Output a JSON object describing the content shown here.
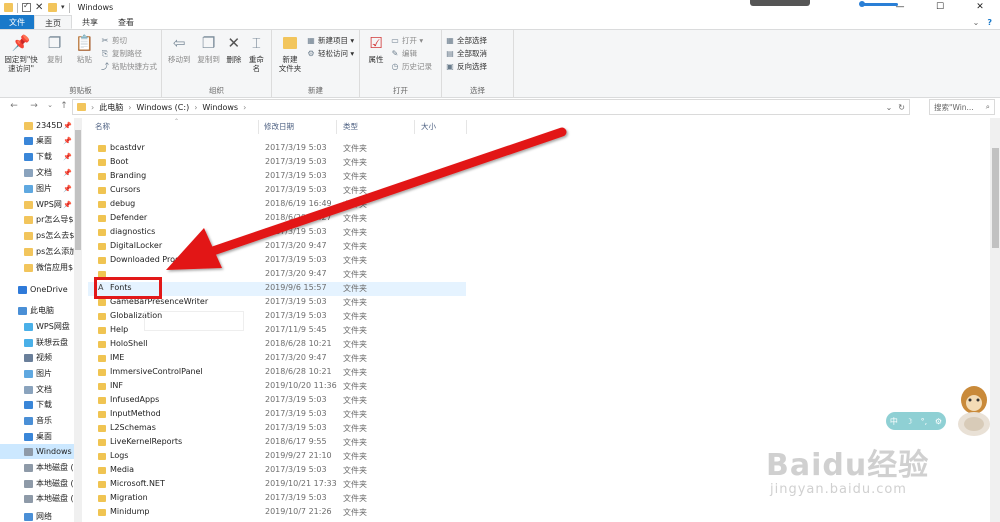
{
  "window": {
    "title": "Windows",
    "controls": {
      "minimize": "—",
      "maximize": "☐",
      "close": "✕"
    }
  },
  "ribbon": {
    "tabs": [
      {
        "label": "文件",
        "kind": "file"
      },
      {
        "label": "主页",
        "kind": "active"
      },
      {
        "label": "共享",
        "kind": "normal"
      },
      {
        "label": "查看",
        "kind": "normal"
      }
    ],
    "right_icons": {
      "expand": "⌄",
      "help": "?"
    },
    "groups": {
      "clipboard": {
        "label": "剪贴板",
        "pin": "固定到\"快速访问\"",
        "copy": "复制",
        "paste": "粘贴",
        "cut": "剪切",
        "copy_path": "复制路径",
        "paste_shortcut": "粘贴快捷方式"
      },
      "organize": {
        "label": "组织",
        "move_to": "移动到",
        "copy_to": "复制到",
        "delete": "删除",
        "rename": "重命名"
      },
      "new": {
        "label": "新建",
        "new_folder": "新建\n文件夹",
        "new_item": "新建项目 ▾",
        "easy_access": "轻松访问 ▾"
      },
      "open": {
        "label": "打开",
        "properties": "属性",
        "open": "打开 ▾",
        "edit": "编辑",
        "history": "历史记录"
      },
      "select": {
        "label": "选择",
        "select_all": "全部选择",
        "select_none": "全部取消",
        "invert": "反向选择"
      }
    }
  },
  "address": {
    "crumbs": [
      "此电脑",
      "Windows (C:)",
      "Windows"
    ],
    "search_placeholder": "搜索\"Win...",
    "back": "←",
    "forward": "→",
    "recent": "⌄",
    "up": "↑",
    "dropdown": "⌄",
    "refresh": "↻",
    "search_icon": "⌕"
  },
  "nav_pane": {
    "items": [
      {
        "label": "2345D",
        "icon": "folder",
        "pinned": true
      },
      {
        "label": "桌面",
        "icon": "desktop",
        "pinned": true
      },
      {
        "label": "下载",
        "icon": "download",
        "pinned": true
      },
      {
        "label": "文档",
        "icon": "doc",
        "pinned": true
      },
      {
        "label": "图片",
        "icon": "pic",
        "pinned": true
      },
      {
        "label": "WPS网",
        "icon": "folder",
        "pinned": true
      },
      {
        "label": "pr怎么导$",
        "icon": "folder",
        "pinned": false
      },
      {
        "label": "ps怎么去$",
        "icon": "folder",
        "pinned": false
      },
      {
        "label": "ps怎么添加",
        "icon": "folder",
        "pinned": false
      },
      {
        "label": "微信应用$",
        "icon": "folder",
        "pinned": false
      },
      {
        "label": "OneDrive",
        "icon": "onedrive",
        "pinned": false
      },
      {
        "label": "此电脑",
        "icon": "pc",
        "pinned": false
      },
      {
        "label": "WPS网盘",
        "icon": "cloud",
        "pinned": false
      },
      {
        "label": "联想云盘",
        "icon": "cloud",
        "pinned": false
      },
      {
        "label": "视频",
        "icon": "video",
        "pinned": false
      },
      {
        "label": "图片",
        "icon": "pic",
        "pinned": false
      },
      {
        "label": "文档",
        "icon": "doc",
        "pinned": false
      },
      {
        "label": "下载",
        "icon": "download",
        "pinned": false
      },
      {
        "label": "音乐",
        "icon": "music",
        "pinned": false
      },
      {
        "label": "桌面",
        "icon": "desktop",
        "pinned": false
      },
      {
        "label": "Windows",
        "icon": "drive",
        "pinned": false,
        "selected": true
      },
      {
        "label": "本地磁盘 (",
        "icon": "drive",
        "pinned": false
      },
      {
        "label": "本地磁盘 (",
        "icon": "drive",
        "pinned": false
      },
      {
        "label": "本地磁盘 (",
        "icon": "drive",
        "pinned": false
      },
      {
        "label": "网络",
        "icon": "network",
        "pinned": false
      }
    ]
  },
  "file_list": {
    "columns": {
      "name": "名称",
      "date": "修改日期",
      "type": "类型",
      "size": "大小"
    },
    "rows": [
      {
        "name": "bcastdvr",
        "date": "2017/3/19 5:03",
        "type": "文件夹"
      },
      {
        "name": "Boot",
        "date": "2017/3/19 5:03",
        "type": "文件夹"
      },
      {
        "name": "Branding",
        "date": "2017/3/19 5:03",
        "type": "文件夹"
      },
      {
        "name": "Cursors",
        "date": "2017/3/19 5:03",
        "type": "文件夹"
      },
      {
        "name": "debug",
        "date": "2018/6/19 16:49",
        "type": "文件夹"
      },
      {
        "name": "Defender",
        "date": "2018/6/20 17:27",
        "type": "文件夹"
      },
      {
        "name": "diagnostics",
        "date": "2017/3/19 5:03",
        "type": "文件夹"
      },
      {
        "name": "DigitalLocker",
        "date": "2017/3/20 9:47",
        "type": "文件夹"
      },
      {
        "name": "Downloaded Program Files",
        "date": "2017/3/19 5:03",
        "type": "文件夹"
      },
      {
        "name": "",
        "date": "2017/3/20 9:47",
        "type": "文件夹"
      },
      {
        "name": "Fonts",
        "date": "2019/9/6 15:57",
        "type": "文件夹",
        "selected": true,
        "icon": "fonts"
      },
      {
        "name": "GameBarPresenceWriter",
        "date": "2017/3/19 5:03",
        "type": "文件夹"
      },
      {
        "name": "Globalization",
        "date": "2017/3/19 5:03",
        "type": "文件夹"
      },
      {
        "name": "Help",
        "date": "2017/11/9 5:45",
        "type": "文件夹"
      },
      {
        "name": "HoloShell",
        "date": "2018/6/28 10:21",
        "type": "文件夹"
      },
      {
        "name": "IME",
        "date": "2017/3/20 9:47",
        "type": "文件夹"
      },
      {
        "name": "ImmersiveControlPanel",
        "date": "2018/6/28 10:21",
        "type": "文件夹"
      },
      {
        "name": "INF",
        "date": "2019/10/20 11:36",
        "type": "文件夹"
      },
      {
        "name": "InfusedApps",
        "date": "2017/3/19 5:03",
        "type": "文件夹"
      },
      {
        "name": "InputMethod",
        "date": "2017/3/19 5:03",
        "type": "文件夹"
      },
      {
        "name": "L2Schemas",
        "date": "2017/3/19 5:03",
        "type": "文件夹"
      },
      {
        "name": "LiveKernelReports",
        "date": "2018/6/17 9:55",
        "type": "文件夹"
      },
      {
        "name": "Logs",
        "date": "2019/9/27 21:10",
        "type": "文件夹"
      },
      {
        "name": "Media",
        "date": "2017/3/19 5:03",
        "type": "文件夹"
      },
      {
        "name": "Microsoft.NET",
        "date": "2019/10/21 17:33",
        "type": "文件夹"
      },
      {
        "name": "Migration",
        "date": "2017/3/19 5:03",
        "type": "文件夹"
      },
      {
        "name": "Minidump",
        "date": "2019/10/7 21:26",
        "type": "文件夹"
      }
    ]
  },
  "widget": {
    "items": [
      "中",
      "☽",
      "°,",
      "⚙"
    ]
  },
  "watermark": {
    "main": "Baidu经验",
    "sub": "jingyan.baidu.com"
  },
  "colors": {
    "accent": "#1979ca",
    "annotation": "#e21818",
    "selection": "#e5f3ff",
    "folder": "#f0c452"
  }
}
